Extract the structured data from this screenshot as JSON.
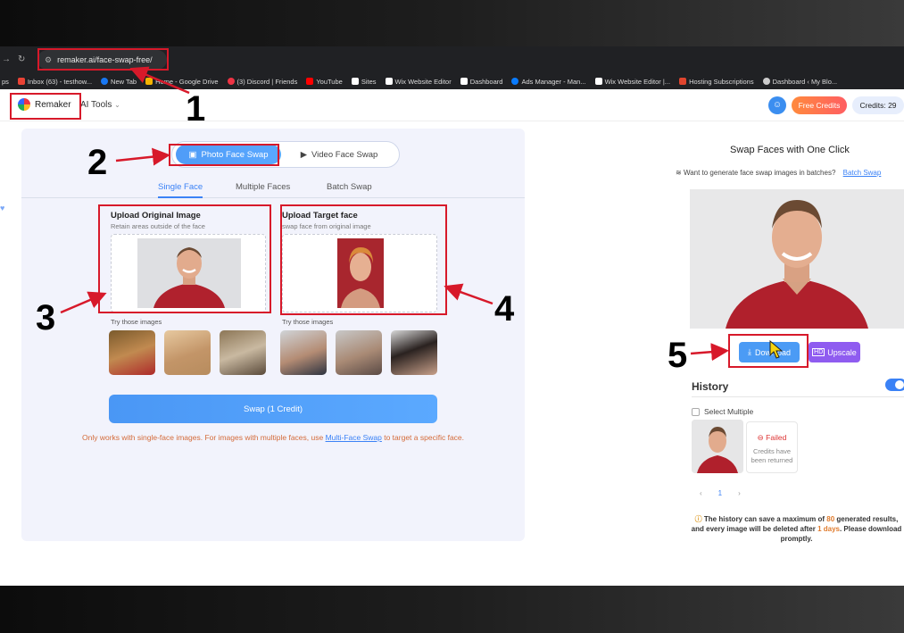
{
  "browser": {
    "left_label": "ps",
    "url": "remaker.ai/face-swap-free/",
    "bookmarks": [
      {
        "label": "Inbox (63) - testhow...",
        "icon": "gmail-icon"
      },
      {
        "label": "New Tab",
        "icon": "facebook-icon"
      },
      {
        "label": "Home - Google Drive",
        "icon": "drive-icon"
      },
      {
        "label": "(3) Discord | Friends",
        "icon": "discord-icon"
      },
      {
        "label": "YouTube",
        "icon": "youtube-icon"
      },
      {
        "label": "Sites",
        "icon": "wix-icon"
      },
      {
        "label": "Wix Website Editor",
        "icon": "wix-icon"
      },
      {
        "label": "Dashboard",
        "icon": "wix-icon"
      },
      {
        "label": "Ads Manager - Man...",
        "icon": "meta-icon"
      },
      {
        "label": "Wix Website Editor |...",
        "icon": "wix-icon"
      },
      {
        "label": "Hosting Subscriptions",
        "icon": "hosting-icon"
      },
      {
        "label": "Dashboard ‹ My Blo...",
        "icon": "wordpress-icon"
      }
    ]
  },
  "header": {
    "brand": "Remaker",
    "ai_tools": "AI Tools",
    "free_credits": "Free Credits",
    "credits": "Credits: 29"
  },
  "swap_panel": {
    "mode_photo": "Photo Face Swap",
    "mode_video": "Video Face Swap",
    "tabs": [
      "Single Face",
      "Multiple Faces",
      "Batch Swap"
    ],
    "original": {
      "title": "Upload Original Image",
      "subtitle": "Retain areas outside of the face"
    },
    "target": {
      "title": "Upload Target face",
      "subtitle": "swap face from original image"
    },
    "try_label": "Try those images",
    "swap_button": "Swap (1 Credit)",
    "notice_before": "Only works with single-face images. For images with multiple faces, use ",
    "notice_link": "Multi-Face Swap",
    "notice_after": " to target a specific face."
  },
  "result": {
    "title": "Swap Faces with One Click",
    "batch_text": "Want to generate face swap images in batches?",
    "batch_link": "Batch Swap",
    "download": "Download",
    "upscale": "Upscale"
  },
  "history": {
    "title": "History",
    "select_multiple": "Select Multiple",
    "failed": "Failed",
    "credits_returned": "Credits have been returned",
    "page": "1",
    "note_a": "The history can save a maximum of ",
    "note_max": "80",
    "note_b": " generated results, and every image will be deleted after ",
    "note_days": "1 days",
    "note_c": ". Please download promptly."
  },
  "annotations": [
    "1",
    "2",
    "3",
    "4",
    "5"
  ],
  "colors": {
    "highlight": "#d7192a",
    "accent": "#3b82f6",
    "orange": "#ff6a45",
    "purple": "#8f5cf0"
  }
}
